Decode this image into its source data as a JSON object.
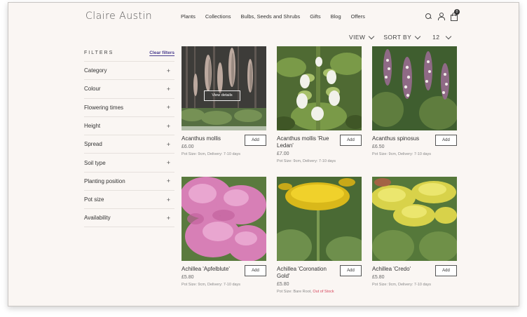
{
  "brand": {
    "logo": "Claire Austin"
  },
  "nav": {
    "items": [
      "Plants",
      "Collections",
      "Bulbs, Seeds and Shrubs",
      "Gifts",
      "Blog",
      "Offers"
    ]
  },
  "header": {
    "cart_count": "0"
  },
  "sort": {
    "view_label": "VIEW",
    "sort_label": "SORT BY",
    "per_page": "12"
  },
  "filters": {
    "title": "FILTERS",
    "clear_label": "Clear filters",
    "items": [
      "Category",
      "Colour",
      "Flowering times",
      "Height",
      "Spread",
      "Soil type",
      "Planting position",
      "Pot size",
      "Availability"
    ]
  },
  "products": [
    {
      "name": "Acanthus mollis",
      "price": "£6.00",
      "meta": "Pot Size: 9cm, Delivery: 7-10 days",
      "meta_extra": "",
      "add_label": "Add",
      "overlay_label": "View details"
    },
    {
      "name": "Acanthus mollis 'Rue Ledan'",
      "price": "£7.00",
      "meta": "Pot Size: 9cm, Delivery: 7-10 days",
      "meta_extra": "",
      "add_label": "Add"
    },
    {
      "name": "Acanthus spinosus",
      "price": "£6.50",
      "meta": "Pot Size: 9cm, Delivery: 7-10 days",
      "meta_extra": "",
      "add_label": "Add"
    },
    {
      "name": "Achillea 'Apfelblute'",
      "price": "£5.80",
      "meta": "Pot Size: 9cm, Delivery: 7-10 days",
      "meta_extra": "",
      "add_label": "Add"
    },
    {
      "name": "Achillea 'Coronation Gold'",
      "price": "£5.80",
      "meta": "Pot Size: Bare Root,",
      "meta_extra": "Out of Stock",
      "add_label": "Add"
    },
    {
      "name": "Achillea 'Credo'",
      "price": "£5.80",
      "meta": "Pot Size: 9cm, Delivery: 7-10 days",
      "meta_extra": "",
      "add_label": "Add"
    }
  ],
  "colors": {
    "accent": "#4a3d8f",
    "out_of_stock": "#d6455c",
    "background": "#faf6f3"
  }
}
